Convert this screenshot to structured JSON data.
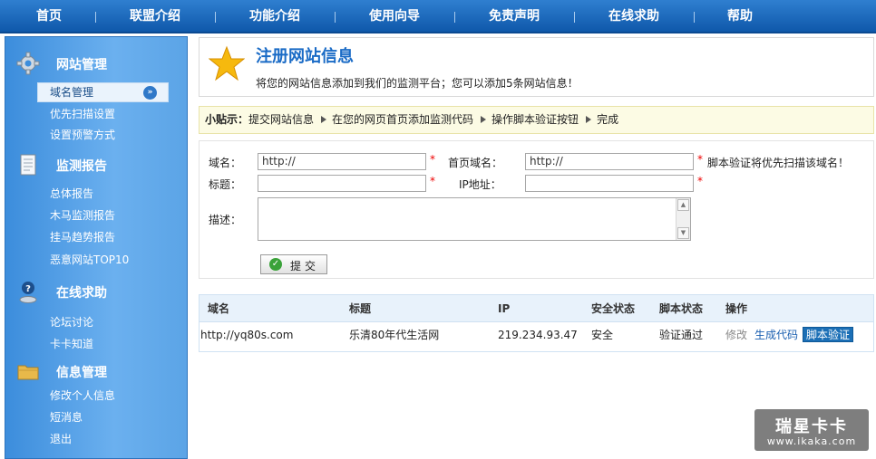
{
  "nav": {
    "items": [
      "首页",
      "联盟介绍",
      "功能介绍",
      "使用向导",
      "免责声明",
      "在线求助",
      "帮助"
    ],
    "separator": "|"
  },
  "sidebar": {
    "sections": [
      {
        "title": "网站管理",
        "icon": "gear-icon",
        "items": [
          "域名管理",
          "优先扫描设置",
          "设置预警方式"
        ],
        "active_index": 0
      },
      {
        "title": "监测报告",
        "icon": "report-icon",
        "items": [
          "总体报告",
          "木马监测报告",
          "挂马趋势报告",
          "恶意网站TOP10"
        ]
      },
      {
        "title": "在线求助",
        "icon": "help-person-icon",
        "items": [
          "论坛讨论",
          "卡卡知道"
        ]
      },
      {
        "title": "信息管理",
        "icon": "folder-icon",
        "items": [
          "修改个人信息",
          "短消息",
          "退出"
        ]
      }
    ],
    "accent": "#4a98e2"
  },
  "header": {
    "title": "注册网站信息",
    "subtitle": "将您的网站信息添加到我们的监测平台；您可以添加5条网站信息！"
  },
  "tips": {
    "label": "小贴示：",
    "steps": [
      "提交网站信息",
      "在您的网页首页添加监测代码",
      "操作脚本验证按钮",
      "完成"
    ]
  },
  "form": {
    "domain_label": "域名：",
    "domain_value": "http://",
    "home_domain_label": "首页域名：",
    "home_domain_value": "http://",
    "home_domain_note": "脚本验证将优先扫描该域名！",
    "title_label": "标题：",
    "title_value": "",
    "ip_label": "IP地址：",
    "ip_value": "",
    "desc_label": "描述：",
    "desc_value": "",
    "required_mark": "*",
    "submit_label": "提交"
  },
  "table": {
    "headers": [
      "域名",
      "标题",
      "IP",
      "安全状态",
      "脚本状态",
      "操作"
    ],
    "rows": [
      {
        "domain": "http://yq80s.com",
        "title": "乐清80年代生活网",
        "ip": "219.234.93.47",
        "security": "安全",
        "script_status": "验证通过",
        "actions": {
          "edit": "修改",
          "gen_code": "生成代码",
          "verify": "脚本验证"
        }
      }
    ]
  },
  "watermark": {
    "line1": "瑞星卡卡",
    "line2": "www.ikaka.com"
  },
  "colors": {
    "nav_bg": "#1565b8",
    "title_blue": "#1a6bc6",
    "required_red": "#e00000",
    "tips_bg": "#fcfbe4"
  }
}
